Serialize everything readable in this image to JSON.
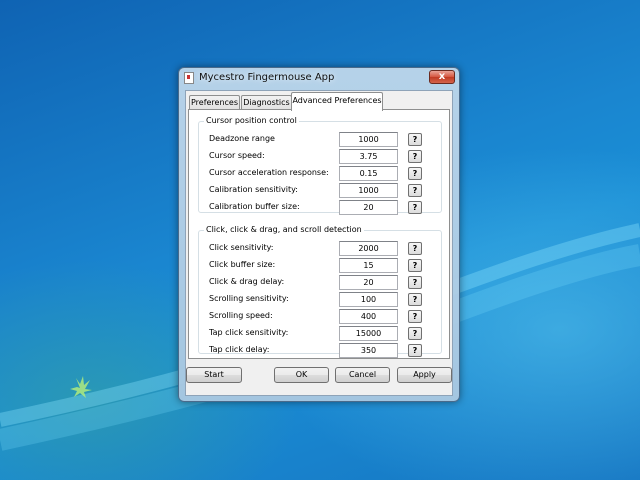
{
  "window": {
    "title": "Mycestro Fingermouse App",
    "close_label": "x"
  },
  "tabs": [
    {
      "label": "Preferences",
      "active": false
    },
    {
      "label": "Diagnostics",
      "active": false
    },
    {
      "label": "Advanced Preferences",
      "active": true
    }
  ],
  "cursor_group": {
    "title": "Cursor position control",
    "rows": [
      {
        "label": "Deadzone range",
        "value": "1000",
        "help": "?"
      },
      {
        "label": "Cursor speed:",
        "value": "3.75",
        "help": "?"
      },
      {
        "label": "Cursor acceleration response:",
        "value": "0.15",
        "help": "?"
      },
      {
        "label": "Calibration sensitivity:",
        "value": "1000",
        "help": "?"
      },
      {
        "label": "Calibration buffer size:",
        "value": "20",
        "help": "?"
      }
    ]
  },
  "click_group": {
    "title": "Click, click & drag, and scroll detection",
    "rows": [
      {
        "label": "Click sensitivity:",
        "value": "2000",
        "help": "?"
      },
      {
        "label": "Click buffer size:",
        "value": "15",
        "help": "?"
      },
      {
        "label": "Click & drag delay:",
        "value": "20",
        "help": "?"
      },
      {
        "label": "Scrolling sensitivity:",
        "value": "100",
        "help": "?"
      },
      {
        "label": "Scrolling speed:",
        "value": "400",
        "help": "?"
      },
      {
        "label": "Tap click sensitivity:",
        "value": "15000",
        "help": "?"
      },
      {
        "label": "Tap click delay:",
        "value": "350",
        "help": "?"
      }
    ]
  },
  "buttons": {
    "start": "Start",
    "ok": "OK",
    "cancel": "Cancel",
    "apply": "Apply"
  }
}
